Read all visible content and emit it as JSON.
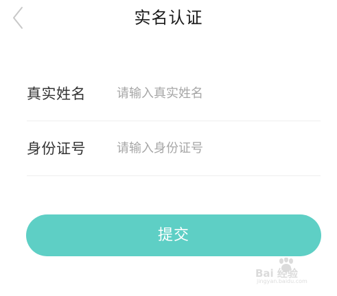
{
  "nav": {
    "back_icon": "chevron-left-icon",
    "title": "实名认证"
  },
  "form": {
    "fields": [
      {
        "label": "真实姓名",
        "value": "",
        "placeholder": "请输入真实姓名"
      },
      {
        "label": "身份证号",
        "value": "",
        "placeholder": "请输入身份证号"
      }
    ]
  },
  "submit": {
    "label": "提交"
  },
  "watermark": {
    "brand": "Bai 经验",
    "url": "jingyan.baidu.com"
  },
  "colors": {
    "accent": "#5ecfc5",
    "title_text": "#1a1a1a",
    "label_text": "#333333",
    "placeholder_text": "#a6a6a6",
    "divider": "#eeeeee",
    "back_icon": "#c8c8c8"
  }
}
